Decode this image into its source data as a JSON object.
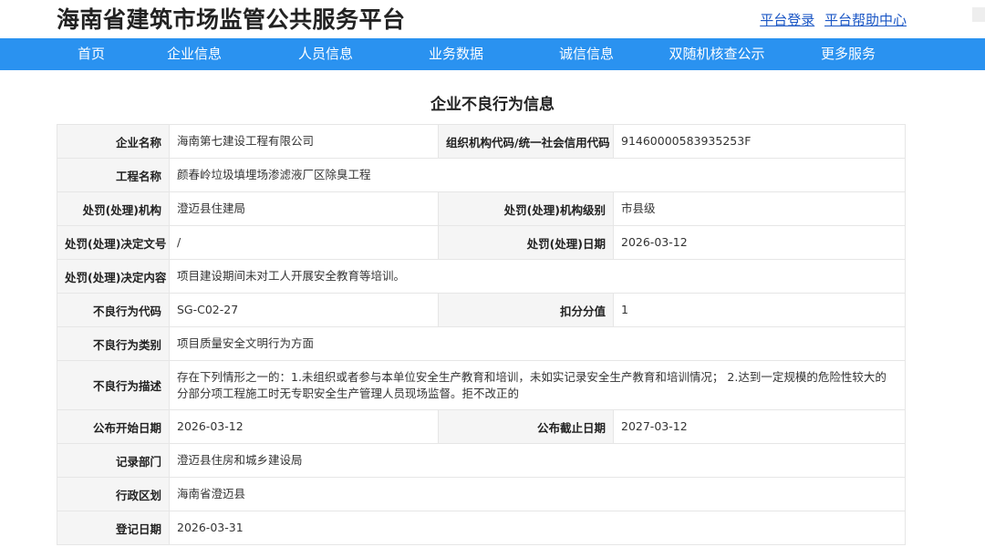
{
  "header": {
    "site_title": "海南省建筑市场监管公共服务平台",
    "login_link": "平台登录",
    "help_link": "平台帮助中心"
  },
  "nav": {
    "items": [
      "首页",
      "企业信息",
      "人员信息",
      "业务数据",
      "诚信信息",
      "双随机核查公示",
      "更多服务"
    ]
  },
  "panel": {
    "title": "企业不良行为信息"
  },
  "record": {
    "company_name_label": "企业名称",
    "company_name": "海南第七建设工程有限公司",
    "org_code_label": "组织机构代码/统一社会信用代码",
    "org_code": "91460000583935253F",
    "project_name_label": "工程名称",
    "project_name": "颜春岭垃圾填埋场渗滤液厂区除臭工程",
    "penalty_org_label": "处罚(处理)机构",
    "penalty_org": "澄迈县住建局",
    "penalty_org_level_label": "处罚(处理)机构级别",
    "penalty_org_level": "市县级",
    "decision_doc_label": "处罚(处理)决定文号",
    "decision_doc": "/",
    "penalty_date_label": "处罚(处理)日期",
    "penalty_date": "2026-03-12",
    "decision_content_label": "处罚(处理)决定内容",
    "decision_content": "项目建设期间未对工人开展安全教育等培训。",
    "bad_code_label": "不良行为代码",
    "bad_code": "SG-C02-27",
    "deduct_label": "扣分分值",
    "deduct": "1",
    "bad_category_label": "不良行为类别",
    "bad_category": "项目质量安全文明行为方面",
    "bad_desc_label": "不良行为描述",
    "bad_desc": "存在下列情形之一的：1.未组织或者参与本单位安全生产教育和培训，未如实记录安全生产教育和培训情况； 2.达到一定规模的危险性较大的分部分项工程施工时无专职安全生产管理人员现场监督。拒不改正的",
    "publish_start_label": "公布开始日期",
    "publish_start": "2026-03-12",
    "publish_end_label": "公布截止日期",
    "publish_end": "2027-03-12",
    "record_dept_label": "记录部门",
    "record_dept": "澄迈县住房和城乡建设局",
    "region_label": "行政区划",
    "region": "海南省澄迈县",
    "register_date_label": "登记日期",
    "register_date": "2026-03-31"
  },
  "colors": {
    "nav_bg": "#2a92f0",
    "link": "#1a56c5",
    "label_bg": "#f5f5f5",
    "border": "#e6e6e6"
  }
}
